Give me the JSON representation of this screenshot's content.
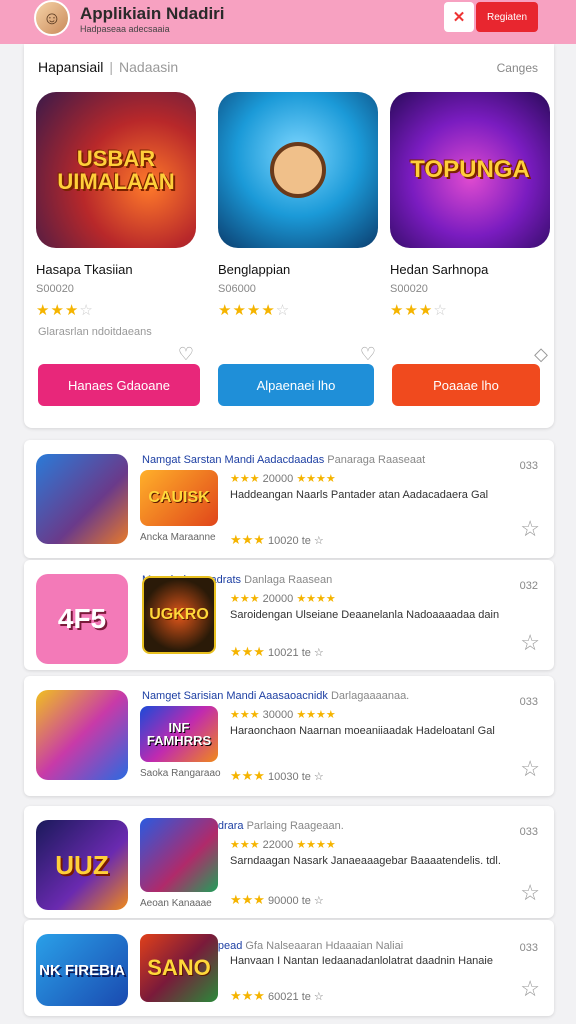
{
  "header": {
    "title": "Applikiain Ndadiri",
    "subtitle": "Hadpaseaa adecsaaia",
    "icon": "sword-icon",
    "register_label": "Regiaten"
  },
  "featured": {
    "heading": "Hapansiail",
    "heading_sub": "Nadaasin",
    "link": "Canges",
    "note": "Glarasrlan ndoitdaeans",
    "cards": [
      {
        "art_text": "USBAR UIMALAAN",
        "name": "Hasapa Tkasiian",
        "num": "S00020",
        "stars": "★★★",
        "stars_off": "☆"
      },
      {
        "art_text": "",
        "name": "Benglappian",
        "num": "S06000",
        "stars": "★★★★",
        "stars_off": "☆"
      },
      {
        "art_text": "TOPUNGA",
        "name": "Hedan Sarhnopa",
        "num": "S00020",
        "stars": "★★★",
        "stars_off": "☆"
      }
    ],
    "buttons": [
      "Hanaes Gdaoane",
      "Alpaenaei lho",
      "Poaaae lho"
    ]
  },
  "list": [
    {
      "thumb1_text": "",
      "thumb2_text": "CAUISK",
      "caption": "Ancka Maraanne",
      "title": "Namgat Sarstan Mandi Aadacdaadas",
      "title_muted": "Panaraga Raaseaat",
      "rating1_stars": "★★★",
      "rating1_num": "20000",
      "rating1_stars2": "★★★★",
      "desc": "Haddeangan Naarls Pantader atan Aadacadaera Gal",
      "rating2_stars": "★★★",
      "rating2_num": "10020",
      "rating2_suffix": "te ☆",
      "count": "033"
    },
    {
      "thumb1_text": "4F5",
      "thumb2_text": "UGKRO",
      "caption": "",
      "title": "Marrair dengaadrats",
      "title_muted": "Danlaga Raasean",
      "rating1_stars": "★★★",
      "rating1_num": "20000",
      "rating1_stars2": "★★★★",
      "desc": "Saroidengan Ulseiane Deaanelanla Nadoaaaadaa dain",
      "rating2_stars": "★★★",
      "rating2_num": "10021",
      "rating2_suffix": "te ☆",
      "count": "032"
    },
    {
      "thumb1_text": "",
      "thumb2_text": "INF FAMHRRS",
      "caption": "Saoka Rangaraao",
      "title": "Namget Sarisian Mandi Aaasaoacnidk",
      "title_muted": "Darlagaaaanaa.",
      "rating1_stars": "★★★",
      "rating1_num": "30000",
      "rating1_stars2": "★★★★",
      "desc": "Haraonchaon Naarnan moeaniiaadak Hadeloatanl Gal",
      "rating2_stars": "★★★",
      "rating2_num": "10030",
      "rating2_suffix": "te ☆",
      "count": "033"
    },
    {
      "thumb1_text": "UUZ",
      "thumb2_text": "",
      "caption": "Aeoan Kanaaae",
      "title": "Pamaa Bengandrara",
      "title_muted": "Parlaing Raageaan.",
      "rating1_stars": "★★★",
      "rating1_num": "22000",
      "rating1_stars2": "★★★★",
      "desc": "Sarndaagan Nasark Janaeaaagebar Baaaatendelis. tdl.",
      "rating2_stars": "★★★",
      "rating2_num": "90000",
      "rating2_suffix": "te ☆",
      "count": "033"
    },
    {
      "thumb1_text": "NK FIREBIA",
      "thumb2_text": "SANO",
      "caption": "",
      "title": "Apppraaan Fhapead",
      "title_muted": "Gfa Nalseaaran Hdaaaian Naliai",
      "rating1_stars": "",
      "rating1_num": "",
      "rating1_stars2": "",
      "desc": "Hanvaan I Nantan Iedaanadanlolatrat daadnin Hanaie",
      "rating2_stars": "★★★",
      "rating2_num": "60021",
      "rating2_suffix": "te ☆",
      "count": "033"
    }
  ],
  "colors": {
    "header_bg": "#f7a1c1",
    "btn_pink": "#e8277a",
    "btn_blue": "#1f8fd8",
    "btn_red": "#f04a1e",
    "link_blue": "#1d3fa3",
    "star": "#f5b400"
  }
}
